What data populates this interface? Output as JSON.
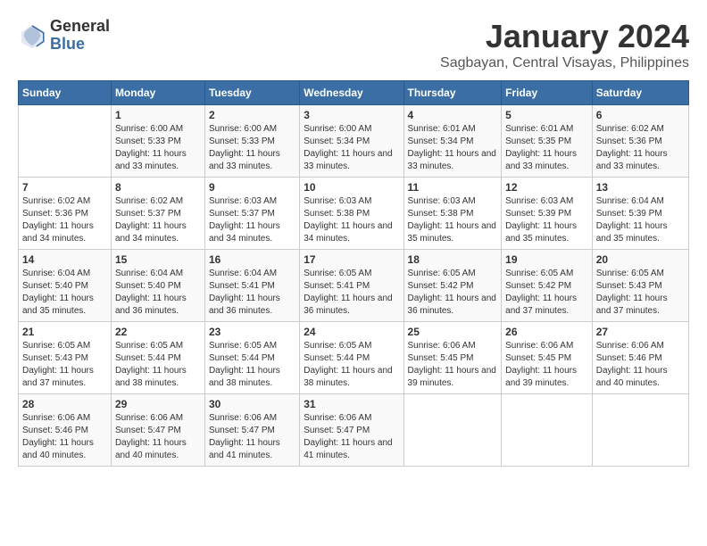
{
  "header": {
    "logo_line1": "General",
    "logo_line2": "Blue",
    "title": "January 2024",
    "subtitle": "Sagbayan, Central Visayas, Philippines"
  },
  "weekdays": [
    "Sunday",
    "Monday",
    "Tuesday",
    "Wednesday",
    "Thursday",
    "Friday",
    "Saturday"
  ],
  "weeks": [
    [
      {
        "day": "",
        "sunrise": "",
        "sunset": "",
        "daylight": ""
      },
      {
        "day": "1",
        "sunrise": "6:00 AM",
        "sunset": "5:33 PM",
        "daylight": "11 hours and 33 minutes."
      },
      {
        "day": "2",
        "sunrise": "6:00 AM",
        "sunset": "5:33 PM",
        "daylight": "11 hours and 33 minutes."
      },
      {
        "day": "3",
        "sunrise": "6:00 AM",
        "sunset": "5:34 PM",
        "daylight": "11 hours and 33 minutes."
      },
      {
        "day": "4",
        "sunrise": "6:01 AM",
        "sunset": "5:34 PM",
        "daylight": "11 hours and 33 minutes."
      },
      {
        "day": "5",
        "sunrise": "6:01 AM",
        "sunset": "5:35 PM",
        "daylight": "11 hours and 33 minutes."
      },
      {
        "day": "6",
        "sunrise": "6:02 AM",
        "sunset": "5:36 PM",
        "daylight": "11 hours and 33 minutes."
      }
    ],
    [
      {
        "day": "7",
        "sunrise": "6:02 AM",
        "sunset": "5:36 PM",
        "daylight": "11 hours and 34 minutes."
      },
      {
        "day": "8",
        "sunrise": "6:02 AM",
        "sunset": "5:37 PM",
        "daylight": "11 hours and 34 minutes."
      },
      {
        "day": "9",
        "sunrise": "6:03 AM",
        "sunset": "5:37 PM",
        "daylight": "11 hours and 34 minutes."
      },
      {
        "day": "10",
        "sunrise": "6:03 AM",
        "sunset": "5:38 PM",
        "daylight": "11 hours and 34 minutes."
      },
      {
        "day": "11",
        "sunrise": "6:03 AM",
        "sunset": "5:38 PM",
        "daylight": "11 hours and 35 minutes."
      },
      {
        "day": "12",
        "sunrise": "6:03 AM",
        "sunset": "5:39 PM",
        "daylight": "11 hours and 35 minutes."
      },
      {
        "day": "13",
        "sunrise": "6:04 AM",
        "sunset": "5:39 PM",
        "daylight": "11 hours and 35 minutes."
      }
    ],
    [
      {
        "day": "14",
        "sunrise": "6:04 AM",
        "sunset": "5:40 PM",
        "daylight": "11 hours and 35 minutes."
      },
      {
        "day": "15",
        "sunrise": "6:04 AM",
        "sunset": "5:40 PM",
        "daylight": "11 hours and 36 minutes."
      },
      {
        "day": "16",
        "sunrise": "6:04 AM",
        "sunset": "5:41 PM",
        "daylight": "11 hours and 36 minutes."
      },
      {
        "day": "17",
        "sunrise": "6:05 AM",
        "sunset": "5:41 PM",
        "daylight": "11 hours and 36 minutes."
      },
      {
        "day": "18",
        "sunrise": "6:05 AM",
        "sunset": "5:42 PM",
        "daylight": "11 hours and 36 minutes."
      },
      {
        "day": "19",
        "sunrise": "6:05 AM",
        "sunset": "5:42 PM",
        "daylight": "11 hours and 37 minutes."
      },
      {
        "day": "20",
        "sunrise": "6:05 AM",
        "sunset": "5:43 PM",
        "daylight": "11 hours and 37 minutes."
      }
    ],
    [
      {
        "day": "21",
        "sunrise": "6:05 AM",
        "sunset": "5:43 PM",
        "daylight": "11 hours and 37 minutes."
      },
      {
        "day": "22",
        "sunrise": "6:05 AM",
        "sunset": "5:44 PM",
        "daylight": "11 hours and 38 minutes."
      },
      {
        "day": "23",
        "sunrise": "6:05 AM",
        "sunset": "5:44 PM",
        "daylight": "11 hours and 38 minutes."
      },
      {
        "day": "24",
        "sunrise": "6:05 AM",
        "sunset": "5:44 PM",
        "daylight": "11 hours and 38 minutes."
      },
      {
        "day": "25",
        "sunrise": "6:06 AM",
        "sunset": "5:45 PM",
        "daylight": "11 hours and 39 minutes."
      },
      {
        "day": "26",
        "sunrise": "6:06 AM",
        "sunset": "5:45 PM",
        "daylight": "11 hours and 39 minutes."
      },
      {
        "day": "27",
        "sunrise": "6:06 AM",
        "sunset": "5:46 PM",
        "daylight": "11 hours and 40 minutes."
      }
    ],
    [
      {
        "day": "28",
        "sunrise": "6:06 AM",
        "sunset": "5:46 PM",
        "daylight": "11 hours and 40 minutes."
      },
      {
        "day": "29",
        "sunrise": "6:06 AM",
        "sunset": "5:47 PM",
        "daylight": "11 hours and 40 minutes."
      },
      {
        "day": "30",
        "sunrise": "6:06 AM",
        "sunset": "5:47 PM",
        "daylight": "11 hours and 41 minutes."
      },
      {
        "day": "31",
        "sunrise": "6:06 AM",
        "sunset": "5:47 PM",
        "daylight": "11 hours and 41 minutes."
      },
      {
        "day": "",
        "sunrise": "",
        "sunset": "",
        "daylight": ""
      },
      {
        "day": "",
        "sunrise": "",
        "sunset": "",
        "daylight": ""
      },
      {
        "day": "",
        "sunrise": "",
        "sunset": "",
        "daylight": ""
      }
    ]
  ]
}
